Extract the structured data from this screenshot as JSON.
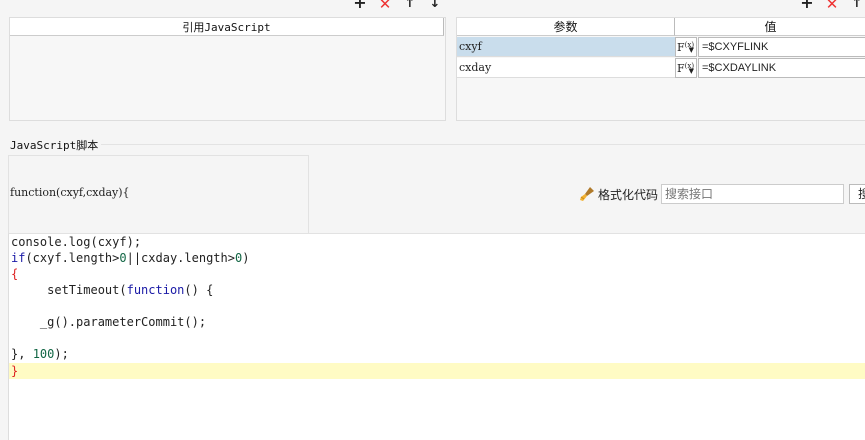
{
  "toolbar_left": {
    "add": "+",
    "delete": "✕",
    "up": "↑",
    "down": "↓"
  },
  "toolbar_right": {
    "add": "+",
    "delete": "✕",
    "up": "↑"
  },
  "ref_js": {
    "header": "引用JavaScript"
  },
  "params": {
    "col_name": "参数",
    "col_value": "值",
    "rows": [
      {
        "name": "cxyf",
        "fx": "F",
        "fx_sub": "(x)",
        "value": "=$CXYFLINK"
      },
      {
        "name": "cxday",
        "fx": "F",
        "fx_sub": "(x)",
        "value": "=$CXDAYLINK"
      }
    ]
  },
  "script": {
    "section_title": "JavaScript脚本",
    "signature": "function(cxyf,cxday){",
    "format_label": "格式化代码",
    "search_placeholder": "搜索接口",
    "search_button_partial": "搜",
    "code": {
      "l1": "console.log(cxyf);",
      "l2_kw": "if",
      "l2_a": "(cxyf.length>",
      "l2_n1": "0",
      "l2_b": "||cxday.length>",
      "l2_n2": "0",
      "l2_c": ")",
      "l3": "{",
      "l4_a": "     setTimeout(",
      "l4_kw": "function",
      "l4_b": "() {",
      "l6": "    _g().parameterCommit();",
      "l8_a": "}, ",
      "l8_n": "100",
      "l8_b": ");",
      "l9": "}"
    }
  },
  "colors": {
    "selected_row": "#c9ddec",
    "current_line": "#fffbc4",
    "keyword": "#1a1aa6",
    "number": "#116644",
    "delete": "#ee3333"
  }
}
